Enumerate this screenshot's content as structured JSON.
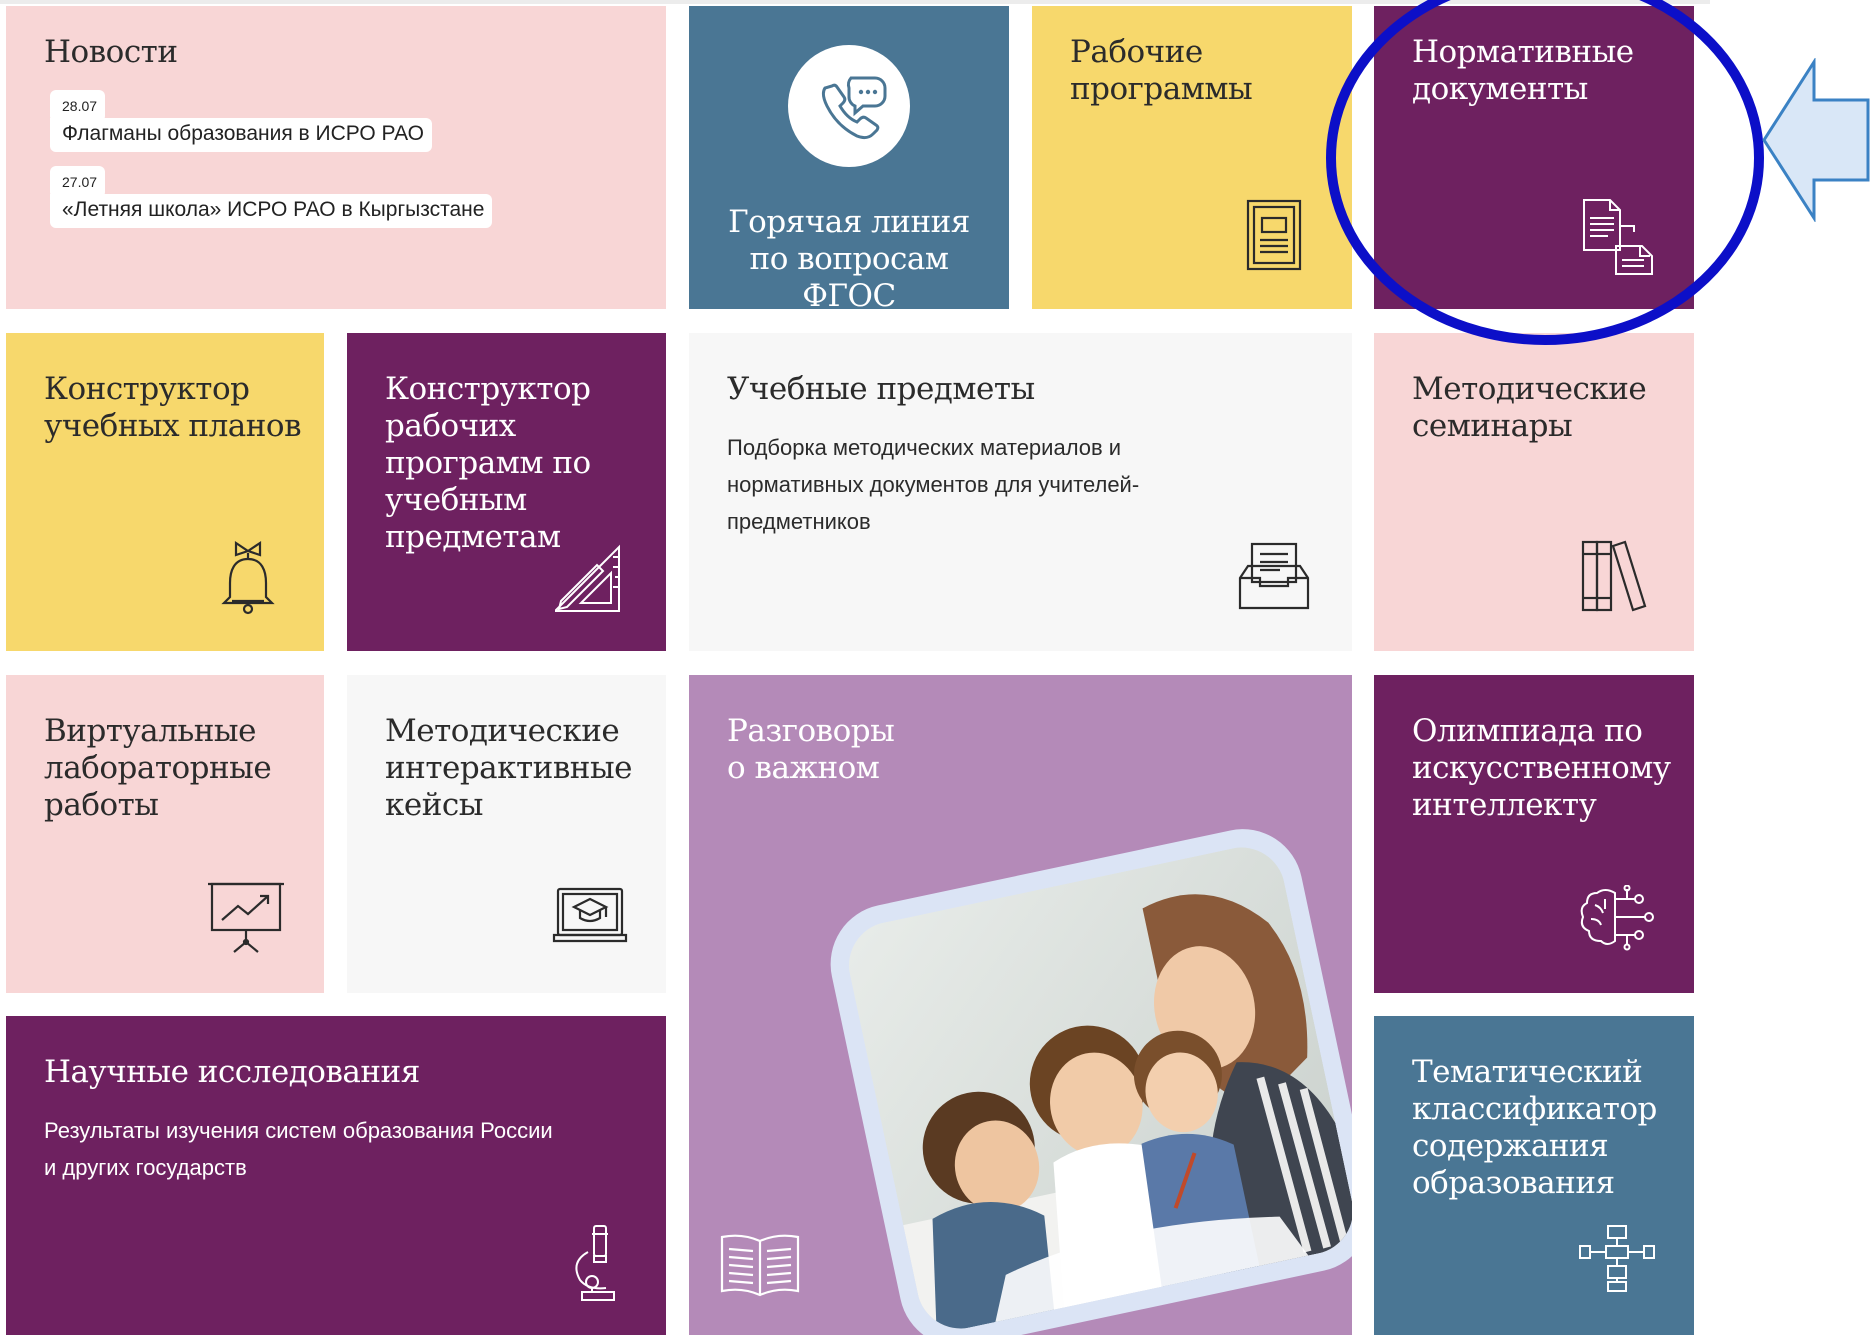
{
  "colors": {
    "pink": "#f8d6d6",
    "steel": "#4a7694",
    "yellow": "#f7d86c",
    "plum": "#6e2160",
    "light": "#f7f7f7",
    "lilac": "#b48ab8",
    "highlight": "#0c0fc8",
    "arrow_fill": "#d9e7f7",
    "arrow_stroke": "#3b82c4"
  },
  "tiles": {
    "news": {
      "title": "Новости",
      "items": [
        {
          "date": "28.07",
          "text": "Флагманы образования в ИСРО РАО"
        },
        {
          "date": "27.07",
          "text": "«Летняя школа» ИСРО РАО в Кыргызстане"
        }
      ]
    },
    "hotline": {
      "line1": "Горячая линия",
      "line2": "по вопросам",
      "line3": "ФГОС",
      "icon": "phone-chat-icon"
    },
    "work_programs": {
      "line1": "Рабочие",
      "line2": "программы",
      "icon": "book-icon"
    },
    "normative_docs": {
      "line1": "Нормативные",
      "line2": "документы",
      "icon": "documents-icon"
    },
    "curriculum_builder": {
      "line1": "Конструктор",
      "line2": "учебных планов",
      "icon": "bell-icon"
    },
    "program_builder": {
      "line1": "Конструктор",
      "line2": "рабочих",
      "line3": "программ по",
      "line4": "учебным",
      "line5": "предметам",
      "icon": "ruler-pencil-icon"
    },
    "subjects": {
      "title": "Учебные предметы",
      "sub1": "Подборка методических материалов и",
      "sub2": "нормативных документов для учителей-",
      "sub3": "предметников",
      "icon": "inbox-tray-icon"
    },
    "seminars": {
      "line1": "Методические",
      "line2": "семинары",
      "icon": "books-icon"
    },
    "virtual_labs": {
      "line1": "Виртуальные",
      "line2": "лабораторные",
      "line3": "работы",
      "icon": "presentation-board-icon"
    },
    "cases": {
      "line1": "Методические",
      "line2": "интерактивные",
      "line3": "кейсы",
      "icon": "laptop-graduation-icon"
    },
    "conversations": {
      "line1": "Разговоры",
      "line2": "о важном",
      "icon": "open-book-icon"
    },
    "ai_olympiad": {
      "line1": "Олимпиада по",
      "line2": "искусственному",
      "line3": "интеллекту",
      "icon": "brain-circuit-icon"
    },
    "research": {
      "title": "Научные исследования",
      "sub1": "Результаты изучения систем образования России",
      "sub2": "и других государств",
      "icon": "microscope-icon"
    },
    "classifier": {
      "line1": "Тематический",
      "line2": "классификатор",
      "line3": "содержания",
      "line4": "образования",
      "icon": "hierarchy-icon"
    }
  }
}
